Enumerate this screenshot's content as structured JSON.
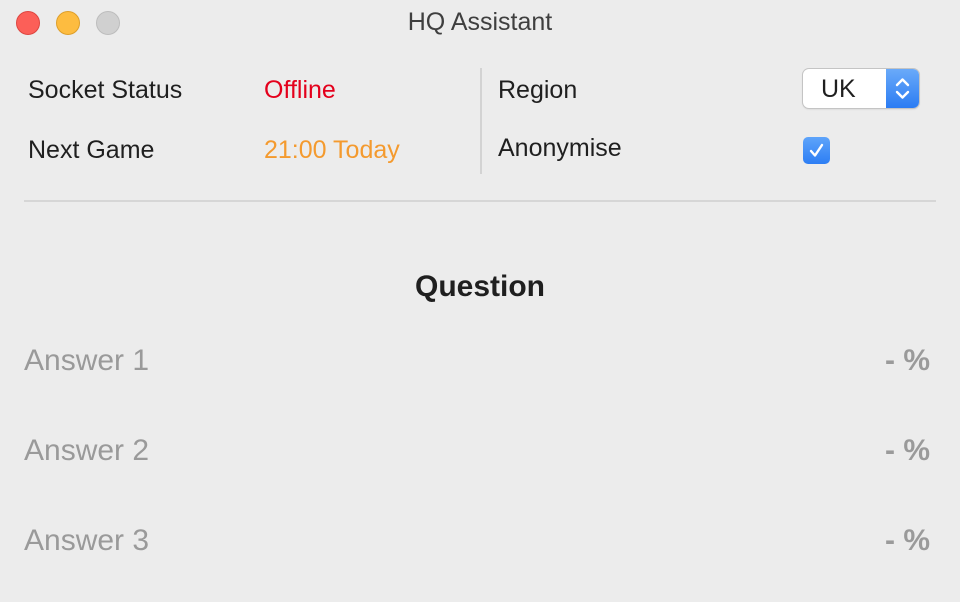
{
  "window": {
    "title": "HQ Assistant"
  },
  "status": {
    "socket_label": "Socket Status",
    "socket_value": "Offline",
    "next_game_label": "Next Game",
    "next_game_value": "21:00 Today"
  },
  "settings": {
    "region_label": "Region",
    "region_value": "UK",
    "anonymise_label": "Anonymise",
    "anonymise_checked": true
  },
  "main": {
    "question": "Question",
    "answers": [
      {
        "label": "Answer 1",
        "percent": "- %"
      },
      {
        "label": "Answer 2",
        "percent": "- %"
      },
      {
        "label": "Answer 3",
        "percent": "- %"
      }
    ]
  },
  "colors": {
    "offline": "#e4001c",
    "next_game": "#f49a2e",
    "accent": "#2d7ef4"
  }
}
